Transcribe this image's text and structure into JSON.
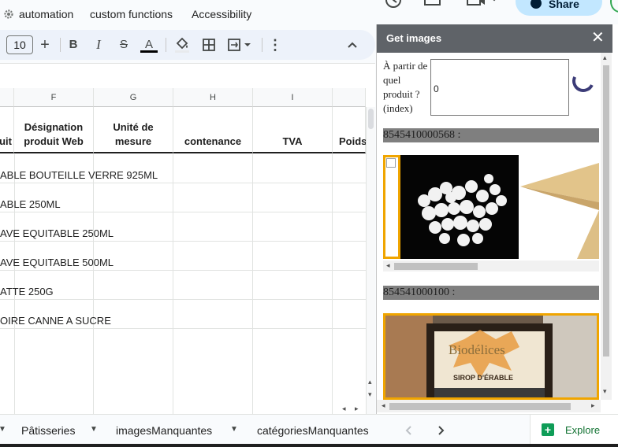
{
  "menubar": {
    "items": [
      "automation",
      "custom functions",
      "Accessibility"
    ],
    "share_label": "Share"
  },
  "toolbar": {
    "font_size": "10",
    "plus_label": "+",
    "bold_label": "B",
    "italic_label": "I",
    "strike_label": "S",
    "text_color_label": "A",
    "more_label": "⋮",
    "collapse_label": "^"
  },
  "grid": {
    "columns": [
      "F",
      "G",
      "H",
      "I"
    ],
    "header_cells": {
      "e_partial": "uit",
      "f": "Désignation produit Web",
      "g": "Unité de mesure",
      "h": "contenance",
      "i": "TVA",
      "j_partial": "Poids"
    },
    "rows": [
      "ABLE BOUTEILLE VERRE 925ML",
      "ABLE 250ML",
      "AVE EQUITABLE 250ML",
      "AVE EQUITABLE 500ML",
      "ATTE 250G",
      "OIRE CANNE A SUCRE"
    ]
  },
  "sheet_tabs": {
    "tabs": [
      "Pâtisseries",
      "imagesManquantes",
      "catégoriesManquantes"
    ],
    "explore_label": "Explore"
  },
  "sidebar": {
    "title": "Get images",
    "label": "À partir de quel produit ? (index)",
    "input_value": "0",
    "products": [
      {
        "code": "8545410000568 :"
      },
      {
        "code": "854541000100 :"
      }
    ],
    "product2_brand": "Biodélices",
    "product2_product": "SIROP D'ÉRABLE"
  },
  "colors": {
    "accent": "#c2e7ff",
    "sidebar_header": "#5f6368",
    "image_border": "#f0a500",
    "explore_green": "#0f9d58"
  }
}
